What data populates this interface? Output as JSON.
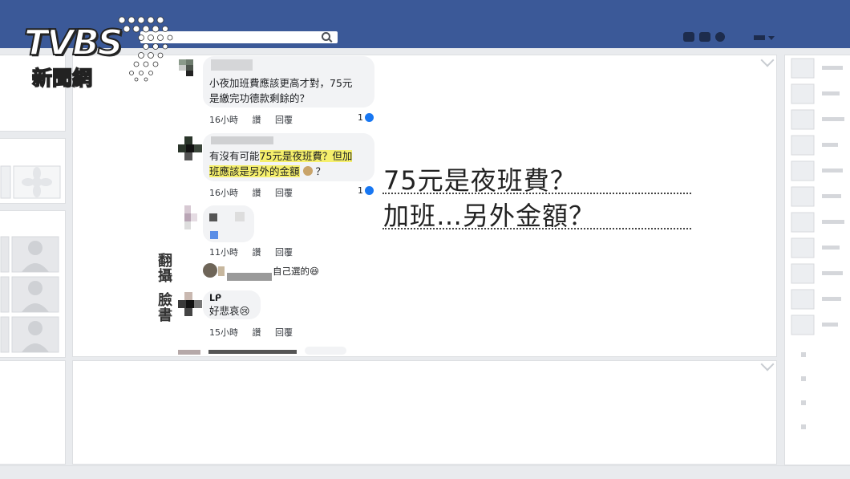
{
  "brand": {
    "logo_main": "TVBS",
    "logo_sub": "新聞網"
  },
  "side_label": [
    "翻",
    "攝",
    "臉",
    "書"
  ],
  "comments": [
    {
      "text_lines": [
        "小夜加班費應該更高才對，75元",
        "是繳完功德款剩餘的？"
      ],
      "time": "16小時",
      "like": "讚",
      "reply": "回覆",
      "reactions": "1"
    },
    {
      "text_lines": [
        "有沒有可能75元是夜班費？但加",
        "班應該是另外的金額",
        "？"
      ],
      "highlight": [
        "75元是夜班費？但加",
        "班應該是另外的金額"
      ],
      "prefix": "有沒有可能",
      "time": "16小時",
      "like": "讚",
      "reply": "回覆",
      "reactions": "1"
    },
    {
      "time": "11小時",
      "like": "讚",
      "reply": "回覆"
    },
    {
      "text": "自己選的😆"
    },
    {
      "name": "ᒪᑭ",
      "text": "好悲哀😢",
      "time": "15小時",
      "like": "讚",
      "reply": "回覆"
    }
  ],
  "headline": {
    "line1": "75元是夜班費？",
    "line2": "加班…另外金額？"
  },
  "colors": {
    "facebook_blue": "#3b5998",
    "highlight_yellow": "#f5ef6c",
    "like_blue": "#1877f2"
  }
}
